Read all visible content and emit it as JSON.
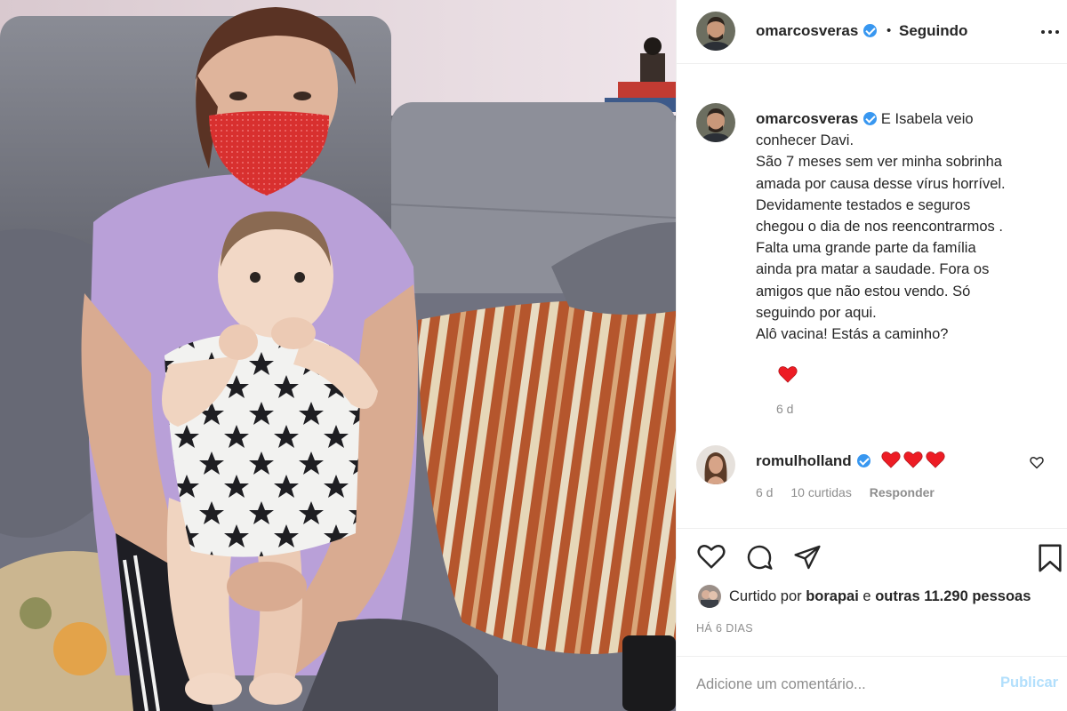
{
  "post": {
    "image_alt": "Photo of a girl in a red mask holding a baby in a star-print onesie on a grey sofa"
  },
  "header": {
    "username": "omarcosveras",
    "separator": "•",
    "follow_status": "Seguindo"
  },
  "caption": {
    "username": "omarcosveras",
    "lines": [
      "E Isabela veio",
      "conhecer Davi.",
      "São 7 meses sem ver minha sobrinha",
      "amada por causa desse vírus horrível.",
      "Devidamente testados e seguros",
      "chegou o dia de nos reencontrarmos .",
      "Falta uma grande parte da família",
      "ainda pra matar a saudade. Fora os",
      "amigos que não estou vendo. Só",
      "seguindo por aqui.",
      "Alô vacina! Estás a caminho?"
    ],
    "emoji": "heart",
    "time_ago": "6 d"
  },
  "comment": {
    "username": "romulholland",
    "emoji": "three-hearts",
    "time_ago": "6 d",
    "likes": "10 curtidas",
    "reply": "Responder"
  },
  "likes": {
    "prefix": "Curtido por ",
    "user": "borapai",
    "middle": " e ",
    "others": "outras 11.290 pessoas"
  },
  "date": "HÁ 6 DIAS",
  "add_comment": {
    "placeholder": "Adicione um comentário...",
    "publish_label": "Publicar"
  },
  "colors": {
    "verified": "#3897f0",
    "heart": "#ed1c24",
    "publish_disabled": "#b2dffc",
    "muted": "#8e8e8e"
  }
}
